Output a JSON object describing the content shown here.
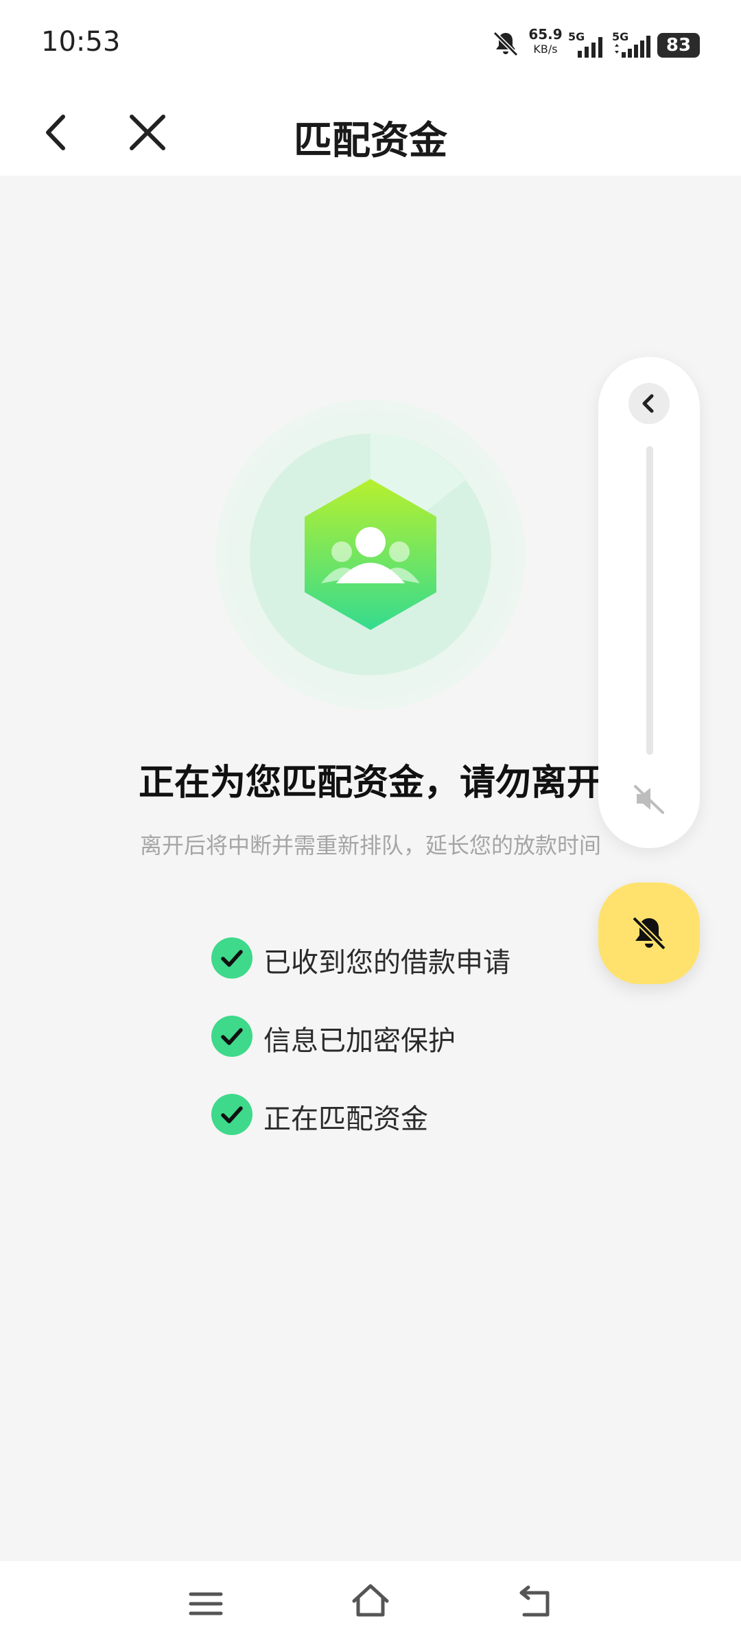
{
  "status_bar": {
    "time": "10:53",
    "net_speed": "65.9",
    "net_speed_unit": "KB/s",
    "sim1_label": "5G",
    "sim2_label": "5G",
    "battery_level": "83",
    "icons": [
      "bell-off-icon",
      "signal-icon",
      "signal-icon",
      "battery-icon"
    ]
  },
  "header": {
    "title": "匹配资金",
    "back_icon": "chevron-left-icon",
    "close_icon": "close-icon"
  },
  "content": {
    "headline": "正在为您匹配资金，请勿离开",
    "subline": "离开后将中断并需重新排队，延长您的放款时间",
    "checklist": [
      {
        "label": "已收到您的借款申请",
        "icon": "check-icon"
      },
      {
        "label": "信息已加密保护",
        "icon": "check-icon"
      },
      {
        "label": "正在匹配资金",
        "icon": "check-icon"
      }
    ],
    "hero_icon": "users-hexagon-icon"
  },
  "volume_panel": {
    "collapse_icon": "chevron-left-icon",
    "mute_icon": "speaker-muted-icon",
    "level": 0
  },
  "ring_mode_button": {
    "icon": "bell-off-icon"
  },
  "bottom_nav": {
    "icons": [
      "menu-icon",
      "home-icon",
      "back-icon"
    ]
  },
  "colors": {
    "accent_green": "#3ed98a",
    "ring_button_yellow": "#ffe26e",
    "background": "#f5f5f5"
  }
}
